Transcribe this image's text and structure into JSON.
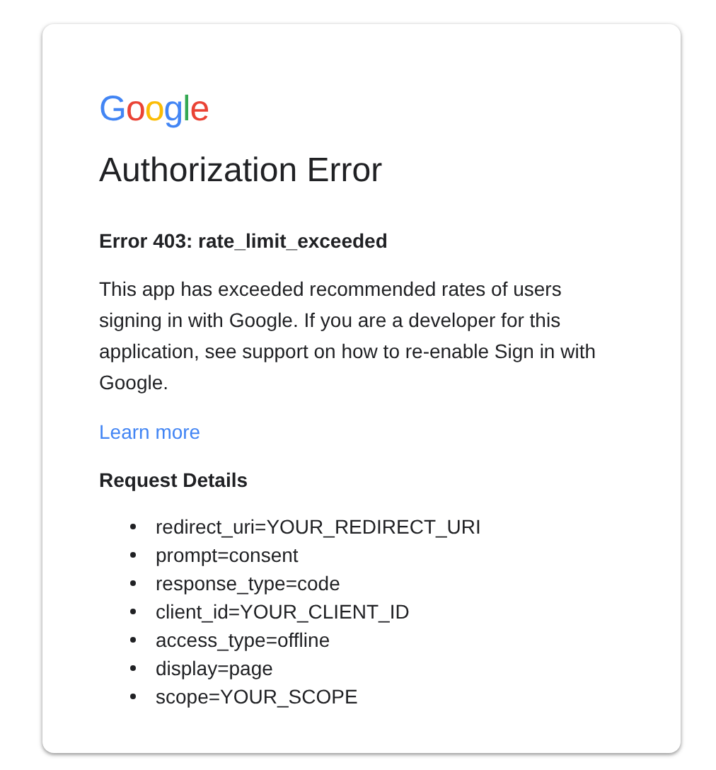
{
  "logo": "Google",
  "title": "Authorization Error",
  "error_heading": "Error 403: rate_limit_exceeded",
  "message": "This app has exceeded recommended rates of users signing in with Google. If you are a developer for this application, see support on how to re-enable Sign in with Google.",
  "link": "Learn more",
  "details_heading": "Request Details",
  "details": [
    "redirect_uri=YOUR_REDIRECT_URI",
    "prompt=consent",
    "response_type=code",
    "client_id=YOUR_CLIENT_ID",
    "access_type=offline",
    "display=page",
    "scope=YOUR_SCOPE"
  ]
}
